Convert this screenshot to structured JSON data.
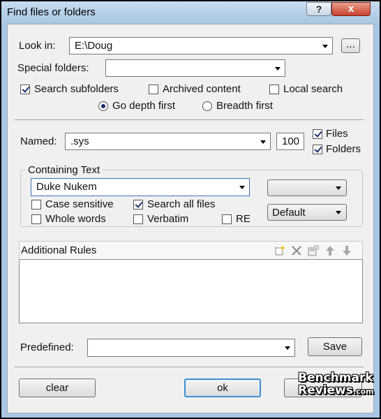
{
  "window": {
    "title": "Find files or folders",
    "help_label": "?",
    "close_label": "x"
  },
  "look_in": {
    "label": "Look in:",
    "value": "E:\\Doug",
    "browse_label": "..."
  },
  "special_folders": {
    "label": "Special folders:",
    "value": ""
  },
  "options": {
    "search_subfolders": {
      "label": "Search subfolders",
      "checked": true
    },
    "archived_content": {
      "label": "Archived content",
      "checked": false
    },
    "local_search": {
      "label": "Local search",
      "checked": false
    },
    "depth_first": {
      "label": "Go depth first",
      "selected": true
    },
    "breadth_first": {
      "label": "Breadth first",
      "selected": false
    }
  },
  "named": {
    "label": "Named:",
    "value": ".sys",
    "count": "100",
    "files": {
      "label": "Files",
      "checked": true
    },
    "folders": {
      "label": "Folders",
      "checked": true
    }
  },
  "containing_text": {
    "legend": "Containing Text",
    "value": "Duke Nukem",
    "encoding_value": "",
    "mode_value": "Default",
    "case_sensitive": {
      "label": "Case sensitive",
      "checked": false
    },
    "search_all_files": {
      "label": "Search all files",
      "checked": true
    },
    "whole_words": {
      "label": "Whole words",
      "checked": false
    },
    "verbatim": {
      "label": "Verbatim",
      "checked": false
    },
    "re": {
      "label": "RE",
      "checked": false
    }
  },
  "additional_rules": {
    "title": "Additional Rules",
    "icons": [
      "new-rule-icon",
      "delete-rule-icon",
      "edit-rule-icon",
      "move-up-icon",
      "move-down-icon"
    ]
  },
  "predefined": {
    "label": "Predefined:",
    "value": "",
    "save_label": "Save"
  },
  "footer": {
    "clear_label": "clear",
    "ok_label": "ok"
  },
  "watermark": {
    "line1": "Benchmark",
    "line2": "Reviews",
    "line2_suffix": ".com"
  },
  "colors": {
    "frame": "#a9c6e3",
    "client": "#f0f0f0",
    "close_button": "#c7402d",
    "check_mark": "#1a2f6b"
  }
}
